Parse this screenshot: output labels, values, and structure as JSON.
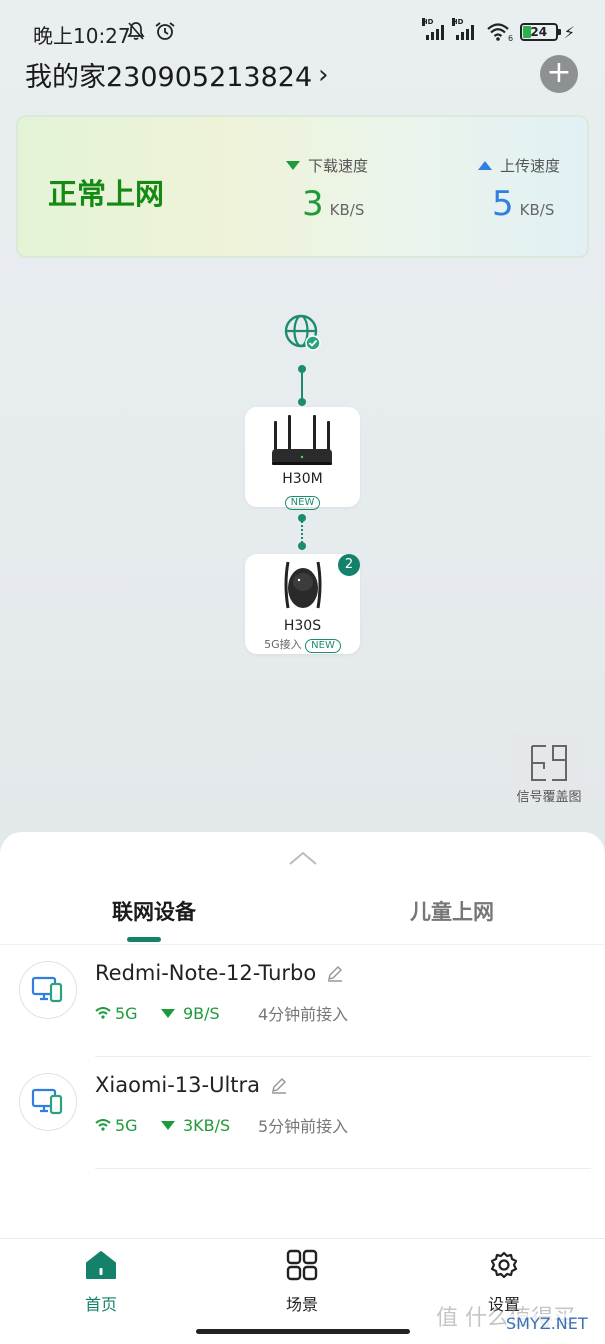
{
  "status_bar": {
    "time": "晚上10:27",
    "hd1": "HD",
    "hd2": "HD",
    "wifi_sub": "6",
    "battery": "24",
    "icons": [
      "mute-bell-icon",
      "alarm-icon",
      "signal-icon",
      "wifi-icon",
      "battery-icon",
      "charging-icon"
    ]
  },
  "header": {
    "home_name": "我的家230905213824",
    "chevron": "›",
    "add_label": "+"
  },
  "net_card": {
    "state": "正常上网",
    "download_label": "下载速度",
    "download_value": "3",
    "download_unit": "KB/S",
    "upload_label": "上传速度",
    "upload_value": "5",
    "upload_unit": "KB/S",
    "colors": {
      "download": "#1f9a3a",
      "upload": "#2f7fe0",
      "state": "#148a14"
    }
  },
  "topology": {
    "node1": {
      "name": "H30M",
      "tag": "NEW"
    },
    "node2": {
      "name": "H30S",
      "sub": "5G接入",
      "tag": "NEW",
      "badge": "2"
    }
  },
  "coverage": {
    "label": "信号覆盖图"
  },
  "sheet": {
    "tabs": [
      "联网设备",
      "儿童上网"
    ],
    "devices": [
      {
        "name": "Redmi-Note-12-Turbo",
        "band": "5G",
        "rate": "9B/S",
        "ago": "4分钟前接入"
      },
      {
        "name": "Xiaomi-13-Ultra",
        "band": "5G",
        "rate": "3KB/S",
        "ago": "5分钟前接入"
      }
    ]
  },
  "nav": {
    "home": "首页",
    "scenes": "场景",
    "settings": "设置"
  },
  "watermark": {
    "text": "值 什么值得买",
    "url": "SMYZ.NET"
  },
  "accent": "#14826a"
}
